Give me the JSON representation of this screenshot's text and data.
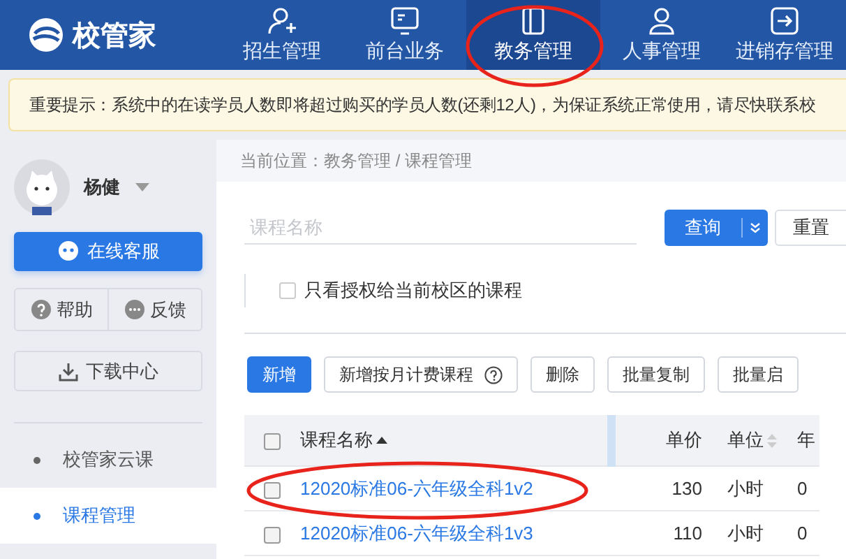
{
  "header": {
    "logo": "校管家",
    "nav": [
      {
        "label": "招生管理",
        "selected": false
      },
      {
        "label": "前台业务",
        "selected": false
      },
      {
        "label": "教务管理",
        "selected": true
      },
      {
        "label": "人事管理",
        "selected": false
      },
      {
        "label": "进销存管理",
        "selected": false
      }
    ]
  },
  "notice": "重要提示：系统中的在读学员人数即将超过购买的学员人数(还剩12人)，为保证系统正常使用，请尽快联系校",
  "sidebar": {
    "user": "杨健",
    "service_button": "在线客服",
    "help": "帮助",
    "feedback": "反馈",
    "download": "下载中心",
    "menu": [
      {
        "label": "校管家云课",
        "selected": false
      },
      {
        "label": "课程管理",
        "selected": true
      }
    ]
  },
  "breadcrumb": "当前位置：教务管理 / 课程管理",
  "search": {
    "placeholder": "课程名称",
    "query_button": "查询",
    "reset_button": "重置"
  },
  "filter": {
    "label": "只看授权给当前校区的课程",
    "checked": false
  },
  "toolbar": [
    {
      "label": "新增",
      "kind": "primary"
    },
    {
      "label": "新增按月计费课程",
      "kind": "help"
    },
    {
      "label": "删除",
      "kind": "plain"
    },
    {
      "label": "批量复制",
      "kind": "plain"
    },
    {
      "label": "批量启",
      "kind": "plain"
    }
  ],
  "table": {
    "header_checked": false,
    "columns": [
      {
        "label": "课程名称",
        "sorted_ascending": true
      },
      {
        "label": "单价"
      },
      {
        "label": "单位",
        "sortable": true
      },
      {
        "label": "年"
      }
    ],
    "rows": [
      {
        "checked": false,
        "cells": [
          "12020标准06-六年级全科1v2",
          "130",
          "小时",
          "0"
        ]
      },
      {
        "checked": false,
        "cells": [
          "12020标准06-六年级全科1v3",
          "110",
          "小时",
          "0"
        ]
      }
    ]
  }
}
